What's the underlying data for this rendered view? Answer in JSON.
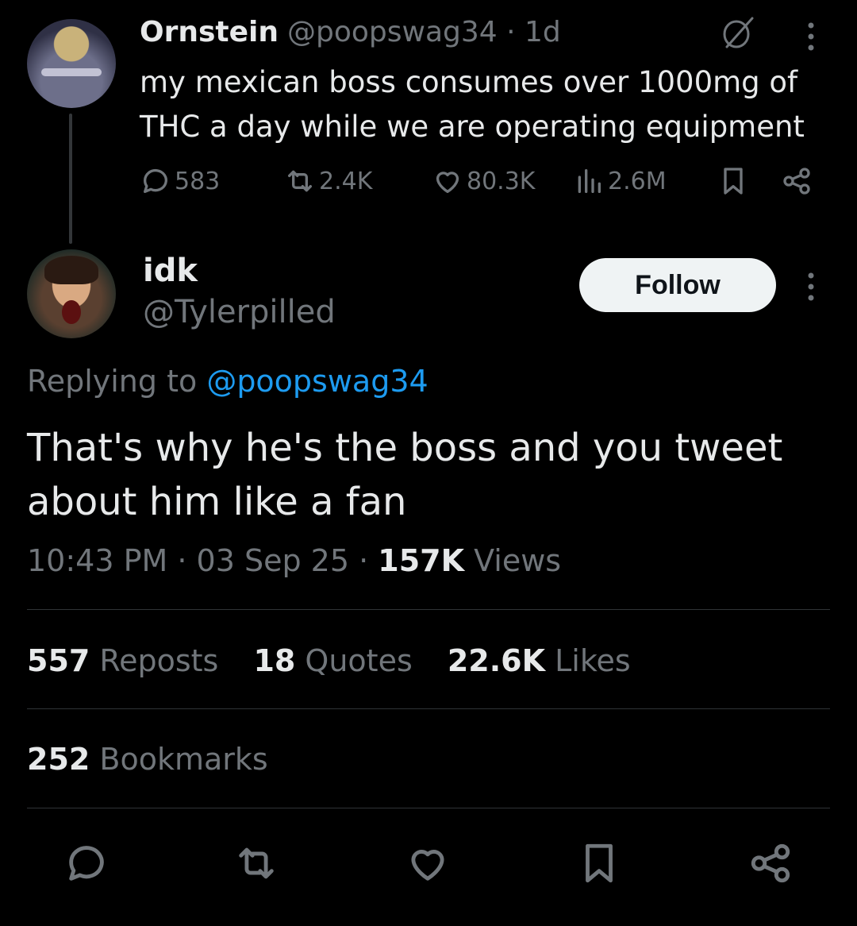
{
  "parent": {
    "name": "Ornstein",
    "handle_time": "@poopswag34 · 1d",
    "text": "my mexican boss consumes over 1000mg of THC a day while we are operating equipment",
    "counts": {
      "replies": "583",
      "reposts": "2.4K",
      "likes": "80.3K",
      "views": "2.6M"
    }
  },
  "reply": {
    "name": "idk",
    "handle": "@Tylerpilled",
    "follow_label": "Follow",
    "replying_prefix": "Replying to ",
    "replying_mention": "@poopswag34",
    "text": "That's why he's the boss and you tweet about him like a fan",
    "timestamp": "10:43 PM · 03 Sep 25 · ",
    "views_count": "157K",
    "views_label": " Views"
  },
  "stats": {
    "reposts_count": "557",
    "reposts_label": " Reposts",
    "quotes_count": "18",
    "quotes_label": " Quotes",
    "likes_count": "22.6K",
    "likes_label": " Likes",
    "bookmarks_count": "252",
    "bookmarks_label": " Bookmarks"
  },
  "icons": {
    "edited": "edited-circle-slash-icon",
    "more": "more-vertical-icon",
    "reply": "reply-bubble-icon",
    "repost": "repost-icon",
    "like": "heart-icon",
    "views": "views-bars-icon",
    "bookmark": "bookmark-icon",
    "share": "share-icon"
  },
  "colors": {
    "background": "#000000",
    "text": "#e7e9ea",
    "muted": "#71767b",
    "link": "#1d9bf0",
    "follow_bg": "#eff3f4"
  }
}
